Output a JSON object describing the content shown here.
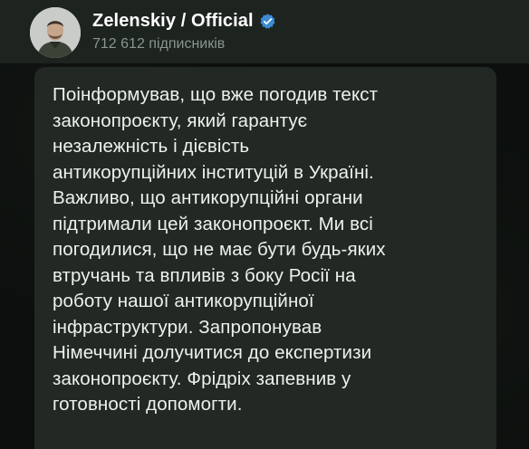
{
  "channel": {
    "name": "Zelenskiy / Official",
    "subscribers": "712 612 підписників",
    "verified_icon": "verified-badge-icon",
    "accent_color": "#3d8bd4"
  },
  "post": {
    "lines": [
      "Поінформував, що вже погодив текст",
      "законопроєкту, який гарантує",
      "незалежність і дієвість",
      "антикорупційних інституцій в Україні.",
      "Важливо, що антикорупційні органи",
      "підтримали цей законопроєкт. Ми всі",
      "погодилися, що не має бути будь-яких",
      "втручань та впливів з боку Росії на",
      "роботу нашої антикорупційної",
      "інфраструктури. Запропонував",
      "Німеччині долучитися до експертизи",
      "законопроєкту. Фрідріх запевнив у",
      "готовності допомогти."
    ]
  }
}
